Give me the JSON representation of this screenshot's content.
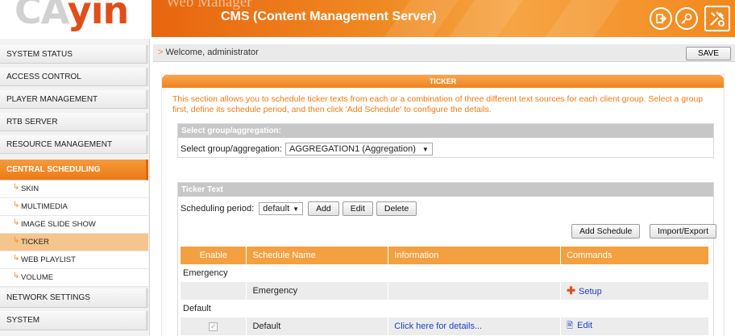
{
  "header": {
    "logo": {
      "part1": "CA",
      "part2": "yin"
    },
    "watermark": "Web Manager",
    "title": "CMS (Content Management Server)",
    "icons": [
      "logout-icon",
      "key-icon",
      "tools-icon"
    ],
    "accent_color": "#f08a22"
  },
  "sidebar": {
    "items": [
      {
        "label": "SYSTEM STATUS"
      },
      {
        "label": "ACCESS CONTROL"
      },
      {
        "label": "PLAYER MANAGEMENT"
      },
      {
        "label": "RTB SERVER"
      },
      {
        "label": "RESOURCE MANAGEMENT"
      },
      {
        "label": "CENTRAL SCHEDULING",
        "active": true
      },
      {
        "label": "NETWORK SETTINGS"
      },
      {
        "label": "SYSTEM"
      }
    ],
    "subitems": [
      {
        "label": "SKIN"
      },
      {
        "label": "MULTIMEDIA"
      },
      {
        "label": "IMAGE SLIDE SHOW"
      },
      {
        "label": "TICKER",
        "active": true
      },
      {
        "label": "WEB PLAYLIST"
      },
      {
        "label": "VOLUME"
      }
    ]
  },
  "welcome": {
    "text": "Welcome, administrator",
    "save_label": "SAVE"
  },
  "panel": {
    "title": "TICKER",
    "description": "This section allows you to schedule ticker texts from each or a combination of three different text sources for each client group. Select a group first, define its schedule period, and then click 'Add Schedule' to configure the details."
  },
  "group_box": {
    "title": "Select group/aggregation:",
    "label": "Select group/aggregation:",
    "selected": "AGGREGATION1 (Aggregation)"
  },
  "ticker_box": {
    "title": "Ticker Text",
    "period_label": "Scheduling period:",
    "period_selected": "default",
    "buttons": {
      "add": "Add",
      "edit": "Edit",
      "delete": "Delete",
      "add_schedule": "Add Schedule",
      "import_export": "Import/Export"
    },
    "table": {
      "headers": [
        "Enable",
        "Schedule Name",
        "Information",
        "Commands"
      ],
      "groups": [
        {
          "name": "Emergency",
          "row": {
            "enabled": false,
            "name": "Emergency",
            "info": "",
            "command": "Setup",
            "command_icon": "plus-icon"
          }
        },
        {
          "name": "Default",
          "row": {
            "enabled": true,
            "name": "Default",
            "info": "Click here for details...",
            "command": "Edit",
            "command_icon": "edit-icon"
          }
        }
      ]
    }
  }
}
